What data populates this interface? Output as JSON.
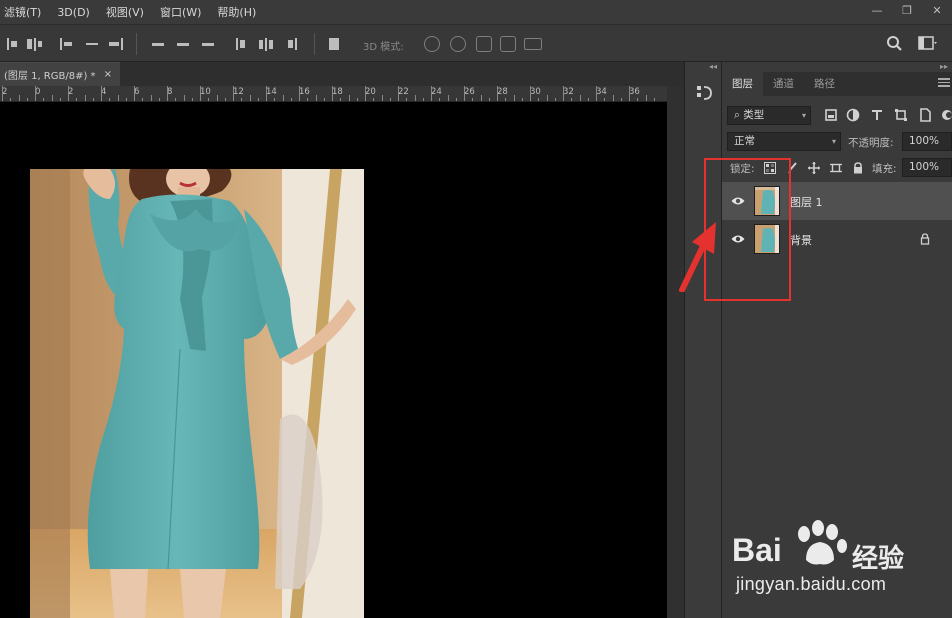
{
  "menu": [
    "滤镜(T)",
    "3D(D)",
    "视图(V)",
    "窗口(W)",
    "帮助(H)"
  ],
  "window_controls": [
    "—",
    "❐",
    "✕"
  ],
  "options_bar": {
    "mode_3d_label": "3D 模式:"
  },
  "document": {
    "tab_title": "(图层 1, RGB/8#) *",
    "close_glyph": "×"
  },
  "ruler_numbers": [
    "2",
    "0",
    "2",
    "4",
    "6",
    "8",
    "10",
    "12",
    "14",
    "16",
    "18",
    "20",
    "22",
    "24",
    "26",
    "28",
    "30",
    "32",
    "34",
    "36"
  ],
  "layers_panel": {
    "tabs": [
      "图层",
      "通道",
      "路径"
    ],
    "filter_kind": "类型",
    "blend_mode": "正常",
    "opacity_label": "不透明度:",
    "opacity_value": "100%",
    "lock_label": "锁定:",
    "fill_label": "填充:",
    "fill_value": "100%",
    "layers": [
      {
        "name": "图层 1",
        "selected": true,
        "visible": true,
        "locked": false
      },
      {
        "name": "背景",
        "selected": false,
        "visible": true,
        "locked": true
      }
    ]
  },
  "annotation": {
    "color": "#e4322f"
  },
  "watermark": {
    "brand": "Bai",
    "brand_suffix": "经验",
    "url": "jingyan.baidu.com"
  },
  "colors": {
    "accent_red": "#e4322f",
    "dress_teal": "#5fb3b4",
    "canvas": "#000000",
    "panel_bg": "#3a3a3a"
  }
}
